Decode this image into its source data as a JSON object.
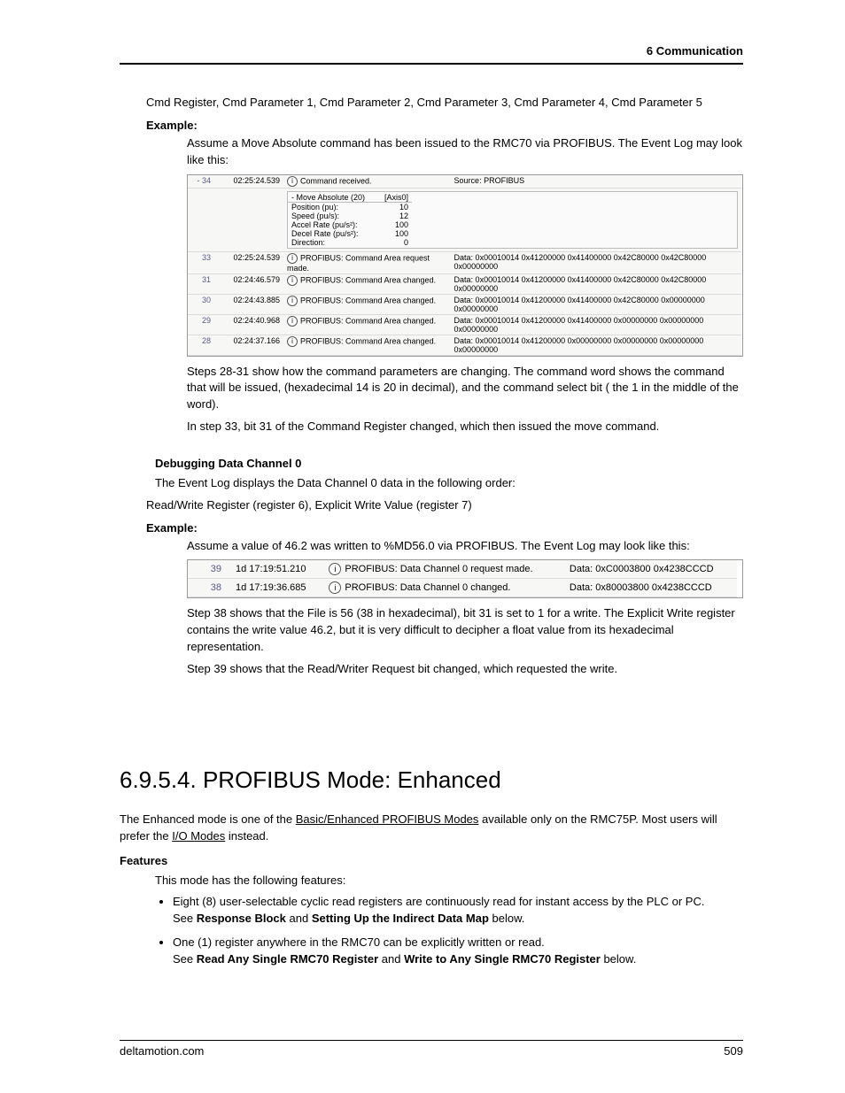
{
  "header": {
    "title": "6  Communication"
  },
  "body": {
    "p_cmd_registers": "Cmd Register, Cmd Parameter 1, Cmd Parameter 2, Cmd Parameter 3, Cmd Parameter 4, Cmd Parameter 5",
    "example1_label": "Example:",
    "example1_intro": "Assume a Move Absolute command has been issued to the RMC70 via PROFIBUS. The Event Log may look like this:",
    "event1": {
      "row34": {
        "num": "34",
        "ts": "02:25:24.539",
        "msg": "Command received.",
        "src": "Source: PROFIBUS"
      },
      "detail": {
        "title_l": "Move Absolute (20)",
        "title_r": "[Axis0]",
        "r1l": "Position (pu):",
        "r1r": "10",
        "r2l": "Speed (pu/s):",
        "r2r": "12",
        "r3l": "Accel Rate (pu/s²):",
        "r3r": "100",
        "r4l": "Decel Rate (pu/s²):",
        "r4r": "100",
        "r5l": "Direction:",
        "r5r": "0"
      },
      "rows": [
        {
          "num": "33",
          "ts": "02:25:24.539",
          "msg": "PROFIBUS: Command Area request made.",
          "data": "Data: 0x00010014 0x41200000 0x41400000 0x42C80000 0x42C80000 0x00000000"
        },
        {
          "num": "31",
          "ts": "02:24:46.579",
          "msg": "PROFIBUS: Command Area changed.",
          "data": "Data: 0x00010014 0x41200000 0x41400000 0x42C80000 0x42C80000 0x00000000"
        },
        {
          "num": "30",
          "ts": "02:24:43.885",
          "msg": "PROFIBUS: Command Area changed.",
          "data": "Data: 0x00010014 0x41200000 0x41400000 0x42C80000 0x00000000 0x00000000"
        },
        {
          "num": "29",
          "ts": "02:24:40.968",
          "msg": "PROFIBUS: Command Area changed.",
          "data": "Data: 0x00010014 0x41200000 0x41400000 0x00000000 0x00000000 0x00000000"
        },
        {
          "num": "28",
          "ts": "02:24:37.166",
          "msg": "PROFIBUS: Command Area changed.",
          "data": "Data: 0x00010014 0x41200000 0x00000000 0x00000000 0x00000000 0x00000000"
        }
      ]
    },
    "p_after1a": "Steps 28-31 show how the command parameters are changing. The command word shows the command that will be issued, (hexadecimal 14 is 20 in decimal), and the command select bit ( the 1 in the middle of the word).",
    "p_after1b": "In step 33, bit 31 of the Command Register changed, which then issued the move command.",
    "subhead_debug": "Debugging Data Channel 0",
    "p_debug1": "The Event Log displays the Data Channel 0 data in the following order:",
    "p_debug2": "Read/Write Register (register 6), Explicit Write Value (register 7)",
    "example2_label": "Example:",
    "example2_intro": "Assume a value of 46.2 was written to %MD56.0 via PROFIBUS. The Event Log may look like this:",
    "event2": {
      "rows": [
        {
          "num": "39",
          "ts": "1d 17:19:51.210",
          "msg": "PROFIBUS: Data Channel 0 request made.",
          "data": "Data: 0xC0003800 0x4238CCCD"
        },
        {
          "num": "38",
          "ts": "1d 17:19:36.685",
          "msg": "PROFIBUS: Data Channel 0 changed.",
          "data": "Data: 0x80003800 0x4238CCCD"
        }
      ]
    },
    "p_after2a": "Step 38 shows that the File is 56 (38 in hexadecimal), bit 31 is set to 1 for a write. The Explicit Write register contains the write value 46.2, but it is very difficult to decipher a float value from its hexadecimal representation.",
    "p_after2b": "Step 39 shows that the Read/Writer Request bit changed, which  requested the write.",
    "section_title": "6.9.5.4. PROFIBUS Mode: Enhanced",
    "p_enh1a": "The Enhanced mode is one of the ",
    "p_enh1_link1": "Basic/Enhanced PROFIBUS Modes",
    "p_enh1b": " available only on the RMC75P. Most users will prefer the ",
    "p_enh1_link2": "I/O Modes",
    "p_enh1c": " instead.",
    "features_label": "Features",
    "p_features_intro": "This mode has the following features:",
    "feat1a": "Eight (8) user-selectable cyclic read registers are continuously read for instant access by the PLC or PC.",
    "feat1b_pre": "See ",
    "feat1b_b1": "Response Block",
    "feat1b_mid": " and ",
    "feat1b_b2": "Setting Up the Indirect Data Map",
    "feat1b_post": " below.",
    "feat2a": "One (1) register anywhere in the RMC70 can be explicitly written or read.",
    "feat2b_pre": "See ",
    "feat2b_b1": "Read Any Single RMC70 Register",
    "feat2b_mid": " and ",
    "feat2b_b2": "Write to Any Single RMC70 Register",
    "feat2b_post": " below."
  },
  "footer": {
    "left": "deltamotion.com",
    "right": "509"
  }
}
